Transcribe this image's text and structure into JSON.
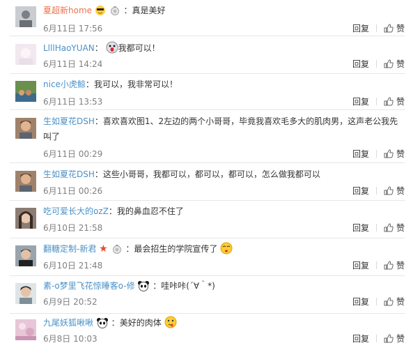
{
  "comments": [
    {
      "name": "夏超新home",
      "sep": "：",
      "text": "真是美好",
      "time": "6月11日 17:56",
      "reply": "回复",
      "like": "赞"
    },
    {
      "name": "LlllHaoYUAN",
      "sep": "：",
      "text": "我都可以！",
      "time": "6月11日 14:24",
      "reply": "回复",
      "like": "赞"
    },
    {
      "name": "nice小虎鲸",
      "sep": "：",
      "text": "我可以，我非常可以！",
      "time": "6月11日 13:53",
      "reply": "回复",
      "like": "赞"
    },
    {
      "name": "生如夏花DSH",
      "sep": "：",
      "text": "喜欢喜欢图1、2左边的两个小哥哥，毕竟我喜欢毛多大的肌肉男，这声老公我先叫了",
      "time": "6月11日 00:29",
      "reply": "回复",
      "like": "赞"
    },
    {
      "name": "生如夏花DSH",
      "sep": "：",
      "text": "这些小哥哥，我都可以，都可以，都可以，怎么做我都可以",
      "time": "6月11日 00:26",
      "reply": "回复",
      "like": "赞"
    },
    {
      "name": "吃可爱长大的ozZ",
      "sep": "：",
      "text": "我的鼻血忍不住了",
      "time": "6月10日 21:58",
      "reply": "回复",
      "like": "赞"
    },
    {
      "name": "翻糖定制-新君",
      "sep": "：",
      "text": "最会招生的学院宣传了",
      "time": "6月10日 21:48",
      "reply": "回复",
      "like": "赞"
    },
    {
      "name": "素-o梦里飞花惊睡客o-修",
      "sep": "：",
      "text": "哇咔咔(´∀｀*)",
      "time": "6月9日 20:52",
      "reply": "回复",
      "like": "赞"
    },
    {
      "name": "九尾妖狐啾啾",
      "sep": "：",
      "text": "美好的肉体",
      "time": "6月8日 10:03",
      "reply": "回复",
      "like": "赞"
    }
  ],
  "icons": {
    "like": "thumbs-up-icon",
    "member": "member-badge-icon",
    "star": "star-icon",
    "emoji": "emoticon-icon"
  },
  "colors": {
    "name": "#eb7350",
    "text": "#333333",
    "meta": "#808080"
  }
}
